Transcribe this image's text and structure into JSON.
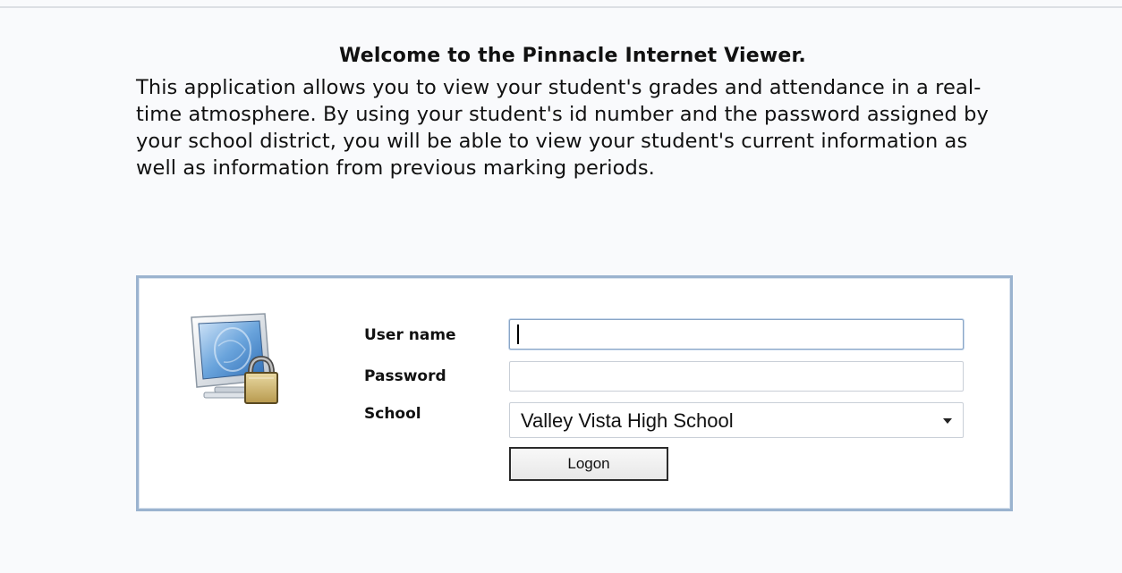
{
  "welcome": {
    "title": "Welcome to the Pinnacle Internet Viewer.",
    "body": "This application allows you to view your student's grades and attendance in a real-time atmosphere. By using your student's id number and the password assigned by your school district, you will be able to view your student's current information as well as information from previous marking periods."
  },
  "login": {
    "icon": "computer-lock-icon",
    "username_label": "User name",
    "username_value": "",
    "password_label": "Password",
    "password_value": "",
    "school_label": "School",
    "school_selected": "Valley Vista High School",
    "logon_label": "Logon"
  },
  "colors": {
    "page_background": "#f9fafc",
    "login_box_border": "#9bb3cf",
    "focused_input_border": "#8aa6c6"
  }
}
